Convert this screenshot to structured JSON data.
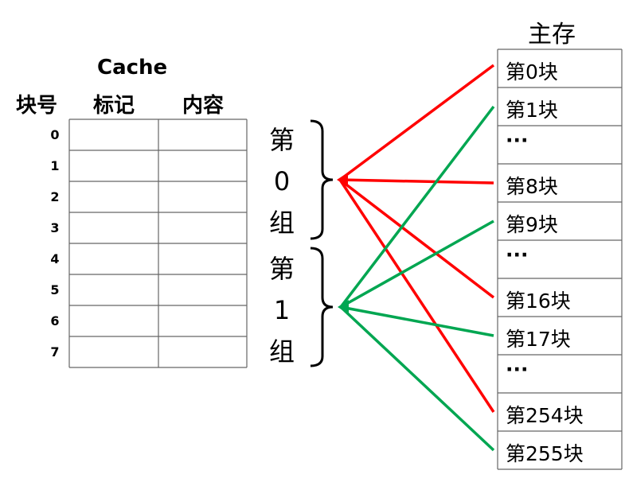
{
  "cache": {
    "title": "Cache",
    "col_block_no": "块号",
    "col_tag": "标记",
    "col_content": "内容",
    "rows": [
      "0",
      "1",
      "2",
      "3",
      "4",
      "5",
      "6",
      "7"
    ]
  },
  "groups": [
    {
      "chars": [
        "第",
        "0",
        "组"
      ],
      "color": "#ff0000"
    },
    {
      "chars": [
        "第",
        "1",
        "组"
      ],
      "color": "#00a651"
    }
  ],
  "memory": {
    "title": "主存",
    "blocks": [
      "第0块",
      "第1块",
      "···",
      "第8块",
      "第9块",
      "···",
      "第16块",
      "第17块",
      "···",
      "第254块",
      "第255块"
    ]
  },
  "mappings": {
    "group0_blocks": [
      "第0块",
      "第8块",
      "第16块",
      "第254块"
    ],
    "group1_blocks": [
      "第1块",
      "第9块",
      "第17块",
      "第255块"
    ]
  }
}
